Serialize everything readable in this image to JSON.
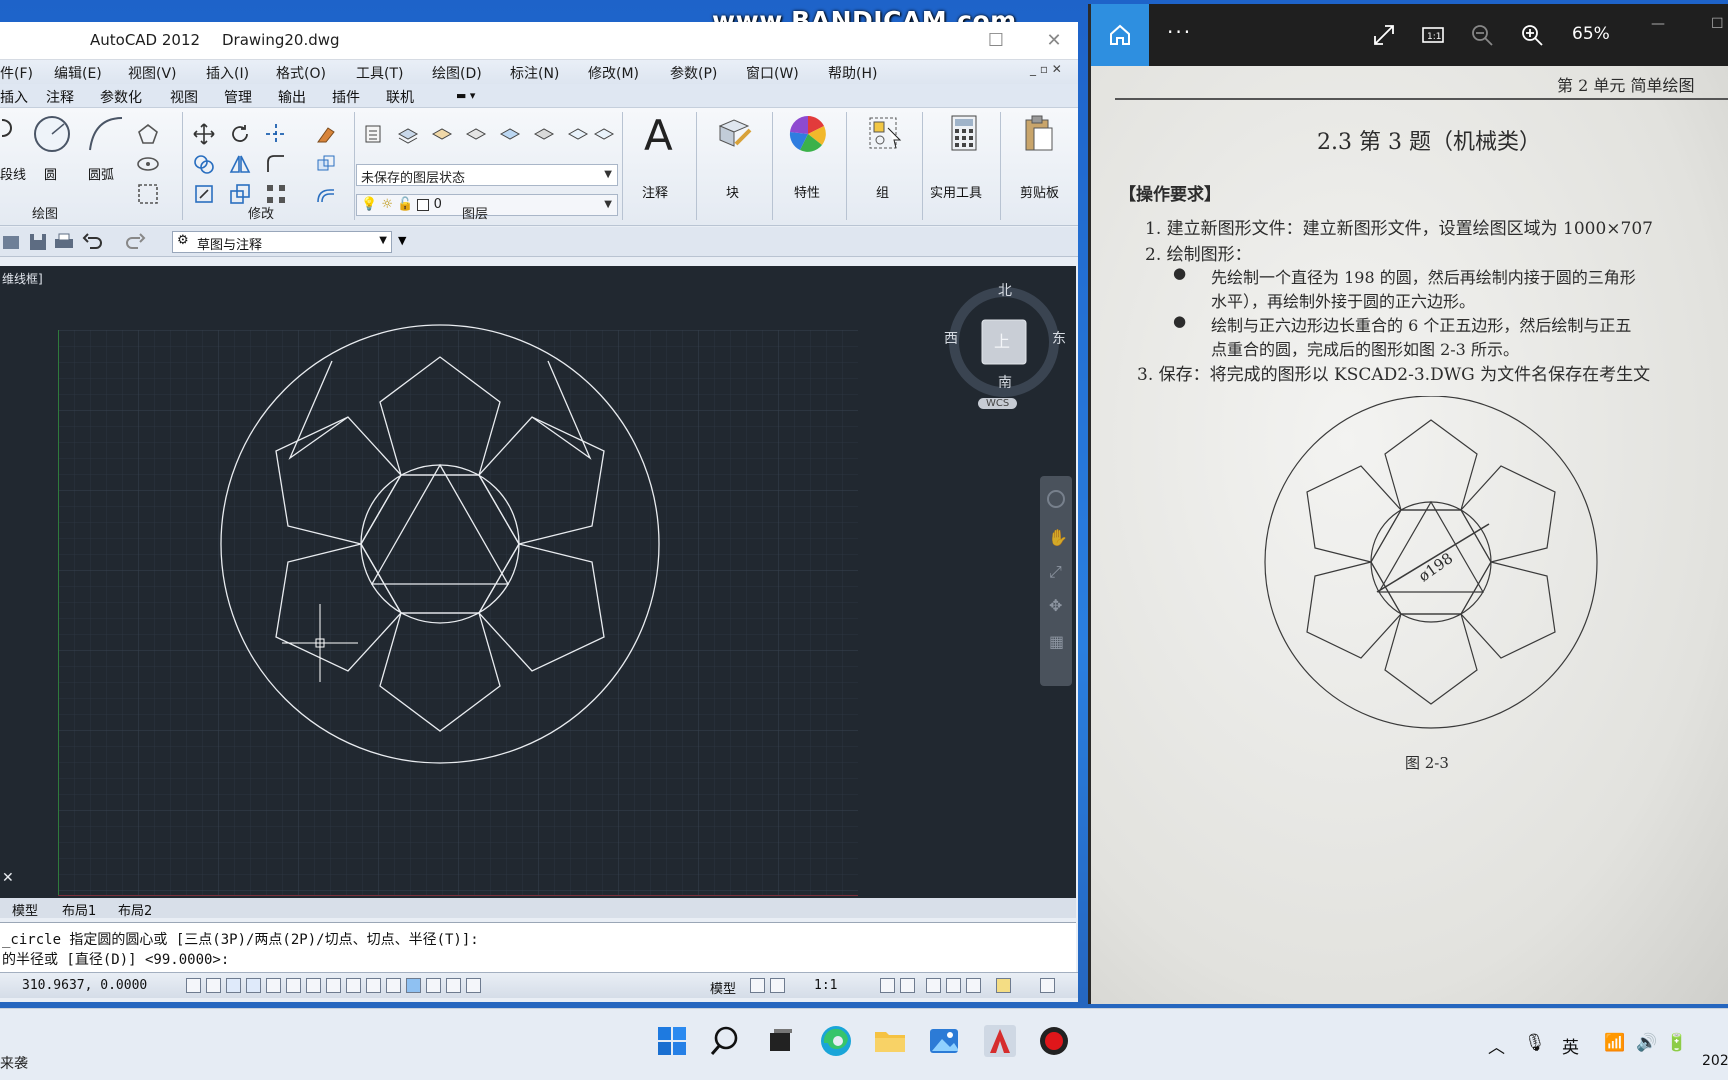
{
  "watermark": "www.BANDICAM.com",
  "acad": {
    "app_name": "AutoCAD 2012",
    "doc_name": "Drawing20.dwg",
    "menu": [
      "件(F)",
      "编辑(E)",
      "视图(V)",
      "插入(I)",
      "格式(O)",
      "工具(T)",
      "绘图(D)",
      "标注(N)",
      "修改(M)",
      "参数(P)",
      "窗口(W)",
      "帮助(H)"
    ],
    "ribbon_tabs": [
      "插入",
      "注释",
      "参数化",
      "视图",
      "管理",
      "输出",
      "插件",
      "联机"
    ],
    "draw_panel": {
      "polyline_label": "段线",
      "circle_label": "圆",
      "arc_label": "圆弧",
      "label": "绘图"
    },
    "modify_panel": {
      "label": "修改"
    },
    "layer_panel": {
      "state": "未保存的图层状态",
      "current_layer": "0",
      "label": "图层"
    },
    "big_buttons": [
      "注释",
      "块",
      "特性",
      "组",
      "实用工具",
      "剪贴板"
    ],
    "workspace": "草图与注释",
    "viewport_label": "维线框]",
    "viewcube": {
      "north": "北",
      "south": "南",
      "west": "西",
      "east": "东",
      "top": "上",
      "wcs": "WCS"
    },
    "layout_tabs": [
      "模型",
      "布局1",
      "布局2"
    ],
    "command_lines": [
      "_circle 指定圆的圆心或 [三点(3P)/两点(2P)/切点、切点、半径(T)]:",
      "的半径或 [直径(D)] <99.0000>:"
    ],
    "coords": "310.9637, 0.0000",
    "status_model": "模型",
    "status_scale": "1:1"
  },
  "viewer": {
    "zoom": "65%",
    "header": "第 2 单元   简单绘图",
    "section_title": "2.3   第 3 题（机械类）",
    "req_title": "【操作要求】",
    "lines": [
      "1.  建立新图形文件：建立新图形文件，设置绘图区域为 1000×707",
      "2.  绘制图形：",
      "先绘制一个直径为 198 的圆，然后再绘制内接于圆的三角形",
      "水平），再绘制外接于圆的正六边形。",
      "绘制与正六边形边长重合的 6 个正五边形，然后绘制与正五",
      "点重合的圆，完成后的图形如图 2-3 所示。",
      "3. 保存：将完成的图形以 KSCAD2-3.DWG 为文件名保存在考生文"
    ],
    "figure_dim": "ø198",
    "figure_caption": "图 2-3"
  },
  "taskbar": {
    "left_text": "来袭",
    "ime": "英",
    "clock_partial": "202"
  }
}
